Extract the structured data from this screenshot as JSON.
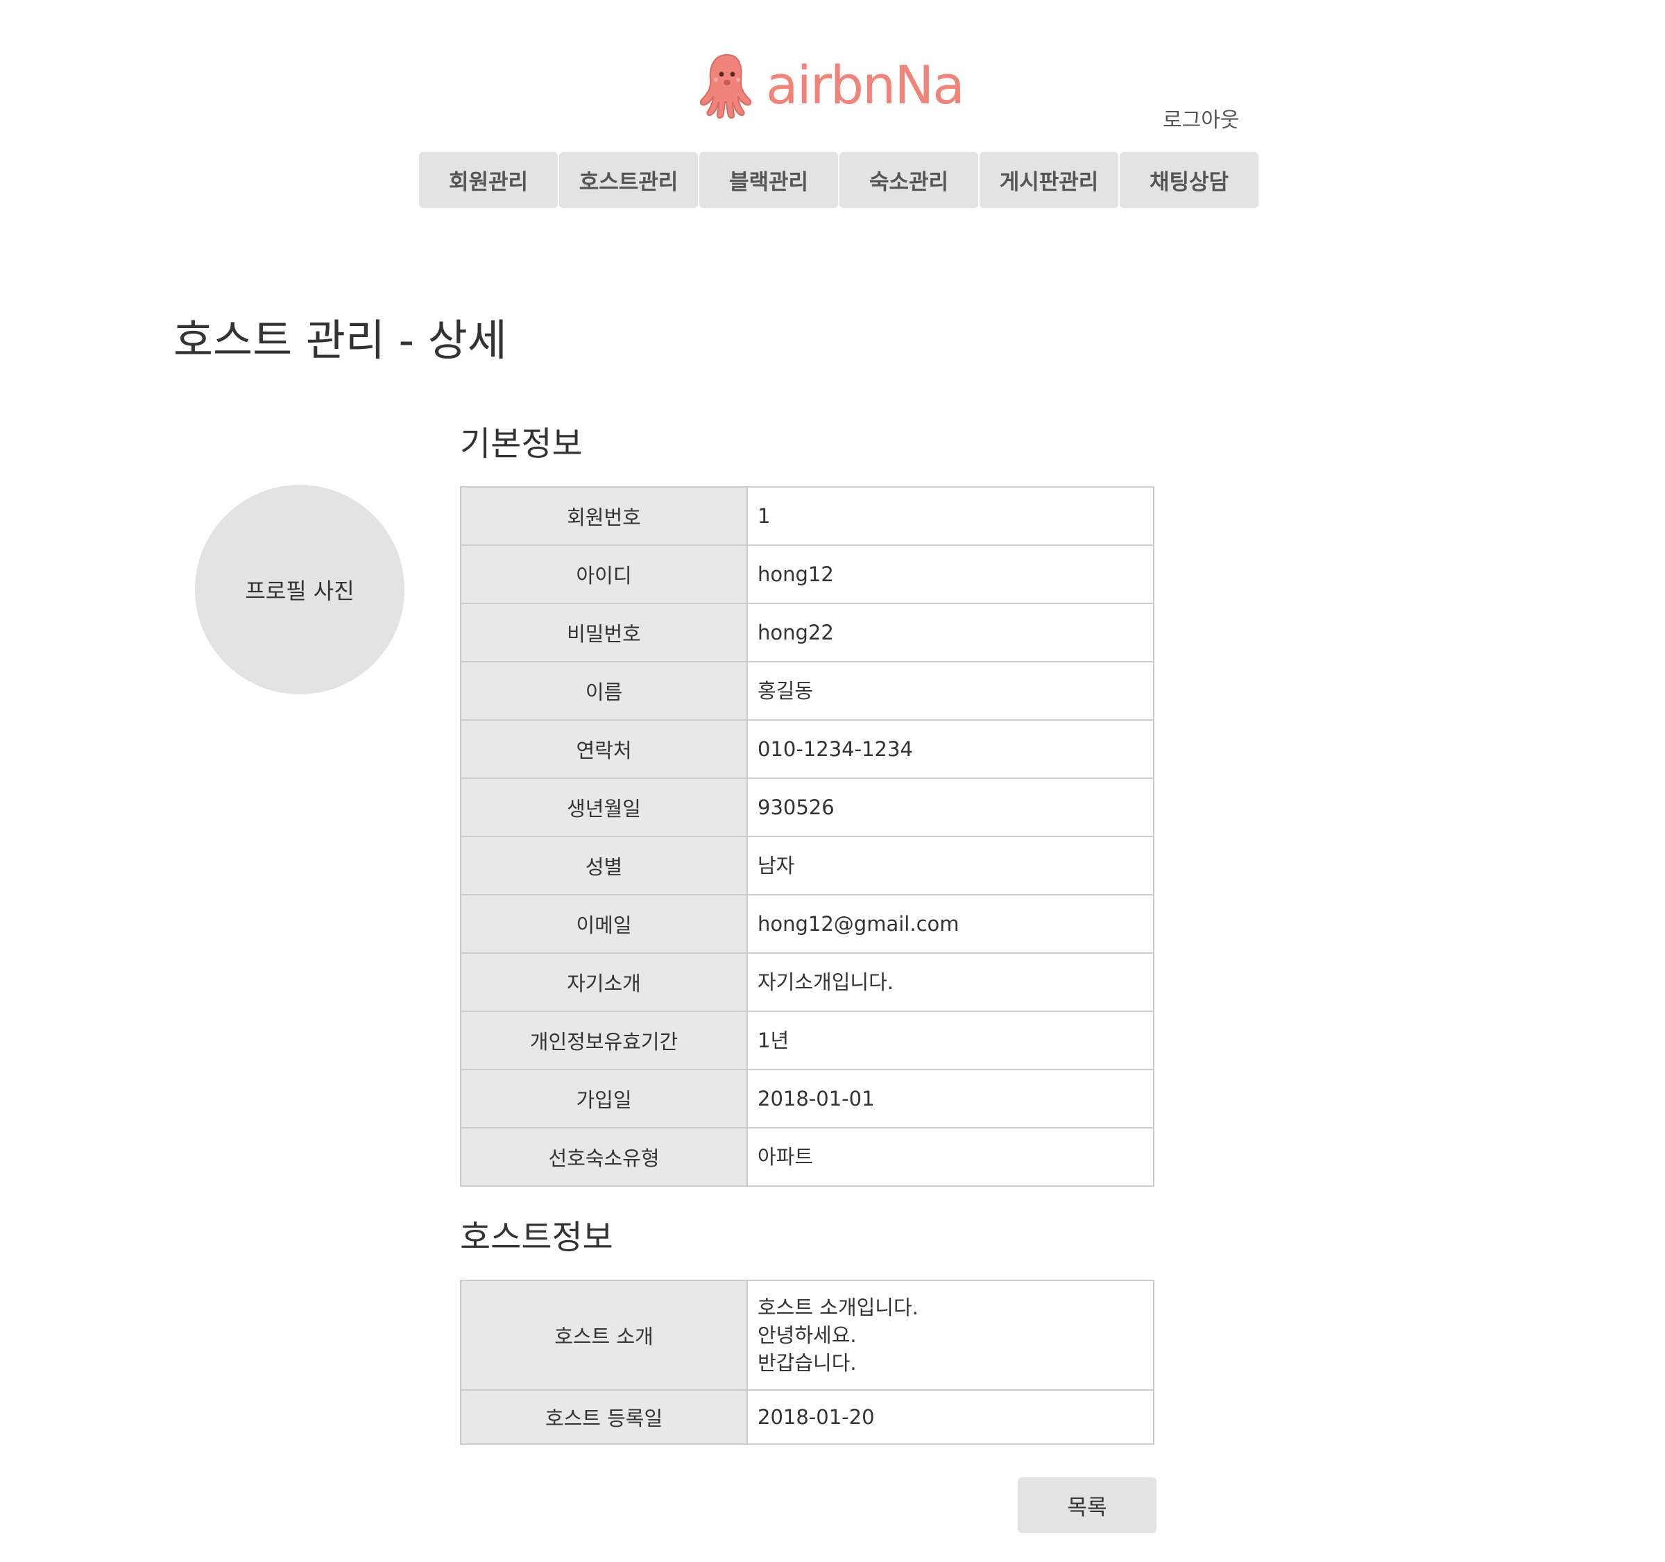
{
  "header": {
    "logo_text": "airbnNa",
    "logo_icon": "octopus-icon",
    "logout_label": "로그아웃"
  },
  "nav": {
    "items": [
      "회원관리",
      "호스트관리",
      "블랙관리",
      "숙소관리",
      "게시판관리",
      "채팅상담"
    ]
  },
  "page": {
    "title": "호스트 관리 - 상세"
  },
  "profile": {
    "placeholder_label": "프로필 사진"
  },
  "basic_info": {
    "title": "기본정보",
    "rows": [
      {
        "label": "회원번호",
        "value": "1"
      },
      {
        "label": "아이디",
        "value": "hong12"
      },
      {
        "label": "비밀번호",
        "value": "hong22"
      },
      {
        "label": "이름",
        "value": "홍길동"
      },
      {
        "label": "연락처",
        "value": "010-1234-1234"
      },
      {
        "label": "생년월일",
        "value": "930526"
      },
      {
        "label": "성별",
        "value": "남자"
      },
      {
        "label": "이메일",
        "value": "hong12@gmail.com"
      },
      {
        "label": "자기소개",
        "value": "자기소개입니다."
      },
      {
        "label": "개인정보유효기간",
        "value": "1년"
      },
      {
        "label": "가입일",
        "value": "2018-01-01"
      },
      {
        "label": "선호숙소유형",
        "value": "아파트"
      }
    ]
  },
  "host_info": {
    "title": "호스트정보",
    "rows": [
      {
        "label": "호스트 소개",
        "value": "호스트 소개입니다.\n안녕하세요.\n반갑습니다."
      },
      {
        "label": "호스트 등록일",
        "value": "2018-01-20"
      }
    ]
  },
  "actions": {
    "list_label": "목록"
  },
  "colors": {
    "brand": "#f0837a",
    "nav_bg": "#e3e3e3",
    "label_bg": "#e8e8e8",
    "border": "#cccccc"
  }
}
